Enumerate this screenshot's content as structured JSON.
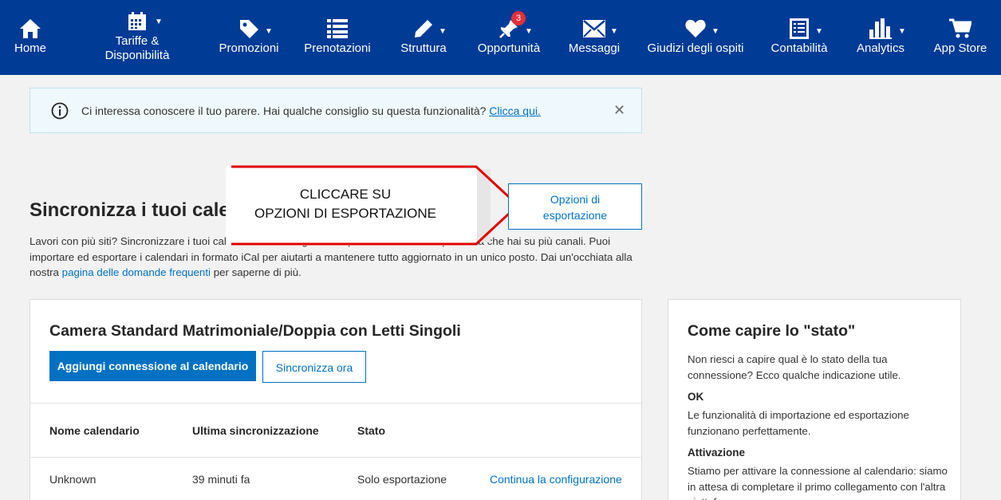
{
  "nav": {
    "items": [
      {
        "label": "Home",
        "icon": "home-icon"
      },
      {
        "label_line1": "Tariffe &",
        "label_line2": "Disponibilità",
        "icon": "calendar-icon"
      },
      {
        "label": "Promozioni",
        "icon": "tag-icon"
      },
      {
        "label": "Prenotazioni",
        "icon": "list-icon"
      },
      {
        "label": "Struttura",
        "icon": "pencil-icon"
      },
      {
        "label": "Opportunità",
        "icon": "pin-icon",
        "badge": "3"
      },
      {
        "label": "Messaggi",
        "icon": "envelope-icon"
      },
      {
        "label": "Giudizi degli ospiti",
        "icon": "heart-icon"
      },
      {
        "label": "Contabilità",
        "icon": "document-icon"
      },
      {
        "label": "Analytics",
        "icon": "bar-chart-icon"
      },
      {
        "label": "App Store",
        "icon": "cart-icon"
      }
    ],
    "caret": "▼"
  },
  "banner": {
    "message": "Ci interessa conoscere il tuo parere. Hai qualche consiglio su questa funzionalità?",
    "link": "Clicca qui.",
    "close": "✕"
  },
  "page": {
    "title": "Sincronizza i tuoi calendari",
    "intro_before": "Lavori con più siti? Sincronizzare i tuoi calendari ti aiuta a gestire le prenotazioni e la disponibilità che hai su più canali. Puoi importare ed esportare i calendari in formato iCal per aiutarti a mantenere tutto aggiornato in un unico posto. Dai un'occhiata alla nostra",
    "intro_link": "pagina delle domande frequenti",
    "intro_after": "per saperne di più.",
    "export_button_line1": "Opzioni di",
    "export_button_line2": "esportazione"
  },
  "callout": {
    "line1": "CLICCARE SU",
    "line2": "OPZIONI DI ESPORTAZIONE",
    "color": "#e00000"
  },
  "room_card": {
    "title": "Camera Standard Matrimoniale/Doppia con Letti Singoli",
    "add_button": "Aggiungi connessione al calendario",
    "sync_button": "Sincronizza ora",
    "table": {
      "headers": [
        "Nome calendario",
        "Ultima sincronizzazione",
        "Stato"
      ],
      "rows": [
        {
          "name": "Unknown",
          "last_sync": "39 minuti fa",
          "status": "Solo esportazione",
          "action": "Continua la configurazione"
        }
      ]
    }
  },
  "side_card": {
    "title": "Come capire lo \"stato\"",
    "intro": "Non riesci a capire qual è lo stato della tua connessione? Ecco qualche indicazione utile.",
    "ok_title": "OK",
    "ok_text": "Le funzionalità di importazione ed esportazione funzionano perfettamente.",
    "activation_title": "Attivazione",
    "activation_text": "Stiamo per attivare la connessione al calendario: siamo in attesa di completare il primo collegamento con l'altra piattaforma."
  },
  "colors": {
    "nav_bg": "#003b95",
    "primary": "#0071c2",
    "badge": "#e0313a"
  }
}
